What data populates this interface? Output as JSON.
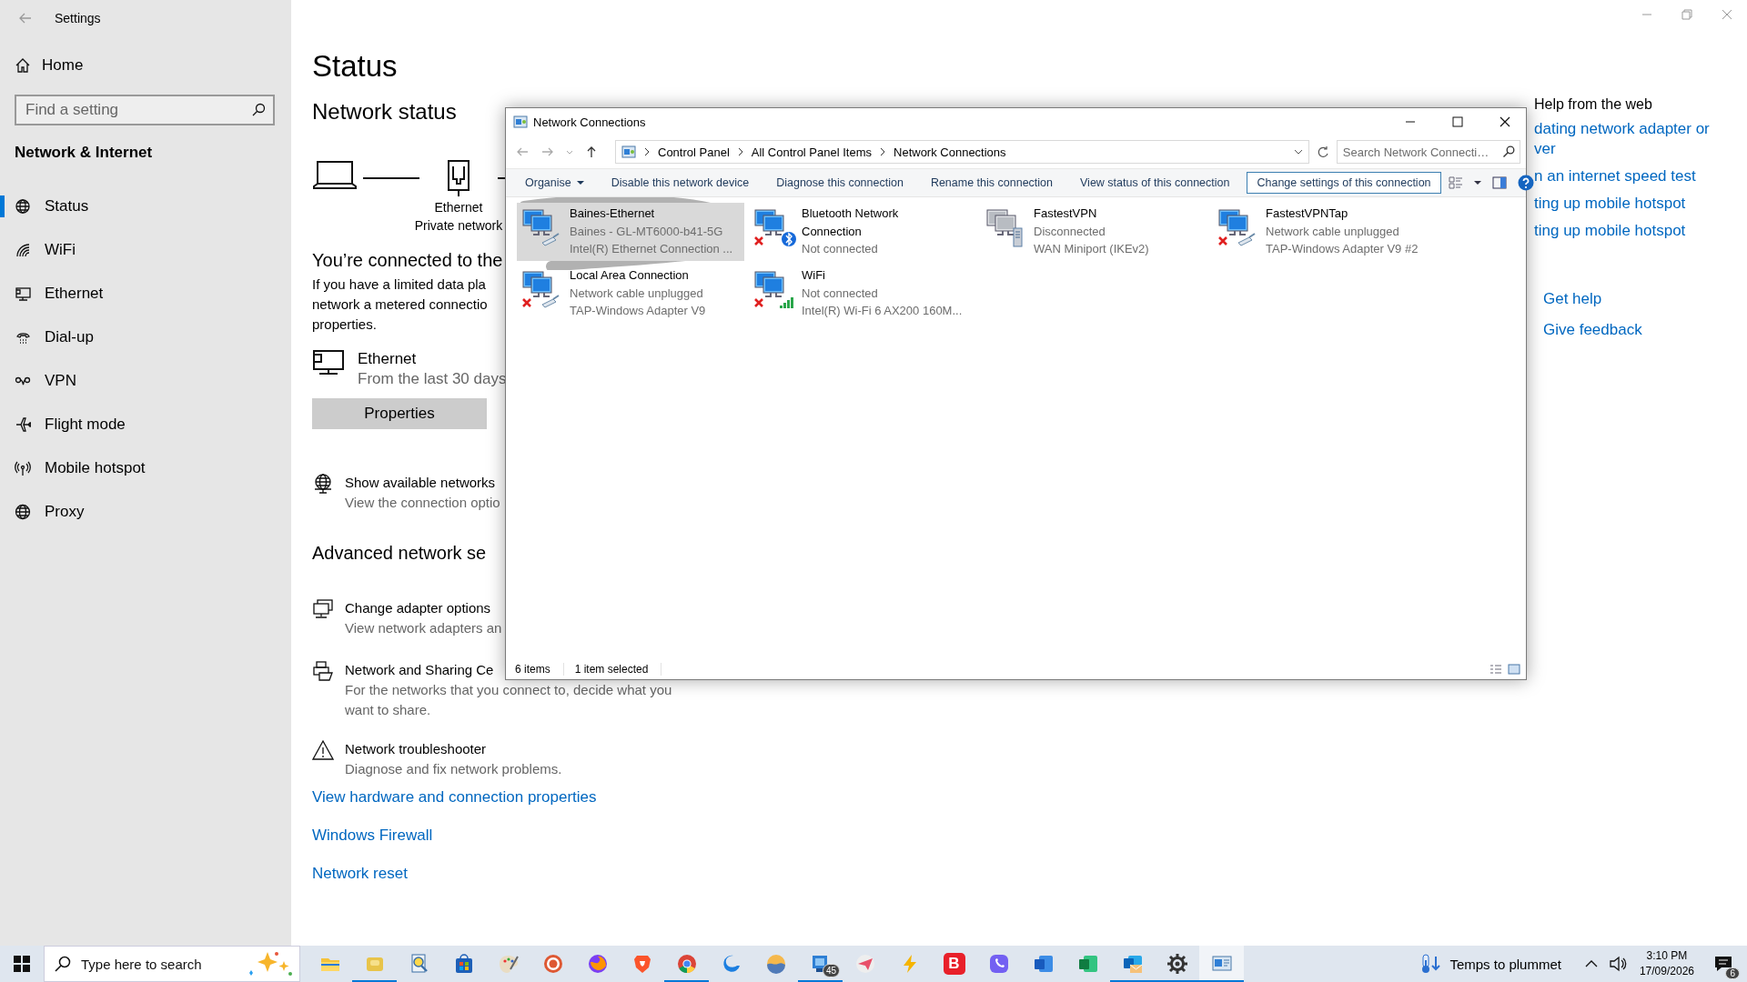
{
  "settings": {
    "title": "Settings",
    "home": "Home",
    "search": {
      "placeholder": "Find a setting"
    },
    "section": "Network & Internet",
    "nav": [
      {
        "label": "Status",
        "selected": true
      },
      {
        "label": "WiFi",
        "selected": false
      },
      {
        "label": "Ethernet",
        "selected": false
      },
      {
        "label": "Dial-up",
        "selected": false
      },
      {
        "label": "VPN",
        "selected": false
      },
      {
        "label": "Flight mode",
        "selected": false
      },
      {
        "label": "Mobile hotspot",
        "selected": false
      },
      {
        "label": "Proxy",
        "selected": false
      }
    ]
  },
  "status_page": {
    "title": "Status",
    "network_status": "Network status",
    "diagram": {
      "adapter": "Ethernet",
      "network": "Private network"
    },
    "connected_heading": "You’re connected to the",
    "body_lines": [
      "If you have a limited data pla",
      "network a metered connectio",
      "properties."
    ],
    "usage": {
      "name": "Ethernet",
      "detail": "From the last 30 days"
    },
    "properties_button": "Properties",
    "show_networks": {
      "title": "Show available networks",
      "detail": "View the connection optio"
    },
    "advanced_heading": "Advanced network se",
    "options": [
      {
        "title": "Change adapter options",
        "detail": "View network adapters an"
      },
      {
        "title": "Network and Sharing Ce",
        "detail": "For the networks that you connect to, decide what you want to share."
      },
      {
        "title": "Network troubleshooter",
        "detail": "Diagnose and fix network problems."
      }
    ],
    "links": [
      "View hardware and connection properties",
      "Windows Firewall",
      "Network reset"
    ]
  },
  "help_panel": {
    "title": "Help from the web",
    "links": [
      {
        "lines": [
          "dating network adapter or",
          "ver"
        ]
      },
      {
        "lines": [
          "n an internet speed test"
        ]
      },
      {
        "lines": [
          "ting up mobile hotspot"
        ]
      },
      {
        "lines": [
          "ting up mobile hotspot"
        ]
      }
    ],
    "support": [
      "Get help",
      "Give feedback"
    ]
  },
  "network_connections": {
    "title": "Network Connections",
    "breadcrumb": [
      "Control Panel",
      "All Control Panel Items",
      "Network Connections"
    ],
    "search": {
      "placeholder": "Search Network Connecti…"
    },
    "toolbar": [
      {
        "label": "Organise",
        "kind": "menu",
        "focused": false
      },
      {
        "label": "Disable this network device",
        "kind": "command",
        "focused": false
      },
      {
        "label": "Diagnose this connection",
        "kind": "command",
        "focused": false
      },
      {
        "label": "Rename this connection",
        "kind": "command",
        "focused": false
      },
      {
        "label": "View status of this connection",
        "kind": "command",
        "focused": false
      },
      {
        "label": "Change settings of this connection",
        "kind": "command",
        "focused": true
      }
    ],
    "items": [
      {
        "name": "Baines-Ethernet",
        "lines": [
          "Baines - GL-MT6000-b41-5G",
          "Intel(R) Ethernet Connection ..."
        ],
        "kind": "ethernet",
        "disconnected": false,
        "selected": true
      },
      {
        "name": "Bluetooth Network Connection",
        "lines": [
          "Not connected"
        ],
        "kind": "bluetooth",
        "disconnected": true,
        "selected": false
      },
      {
        "name": "FastestVPN",
        "lines": [
          "Disconnected",
          "WAN Miniport (IKEv2)"
        ],
        "kind": "vpn",
        "disconnected": false,
        "selected": false
      },
      {
        "name": "FastestVPNTap",
        "lines": [
          "Network cable unplugged",
          "TAP-Windows Adapter V9 #2"
        ],
        "kind": "tap",
        "disconnected": true,
        "selected": false
      },
      {
        "name": "Local Area Connection",
        "lines": [
          "Network cable unplugged",
          "TAP-Windows Adapter V9"
        ],
        "kind": "tap",
        "disconnected": true,
        "selected": false
      },
      {
        "name": "WiFi",
        "lines": [
          "Not connected",
          "Intel(R) Wi-Fi 6 AX200 160M..."
        ],
        "kind": "wifi",
        "disconnected": true,
        "selected": false
      }
    ],
    "status_bar": [
      "6 items",
      "1 item selected"
    ]
  },
  "taskbar": {
    "search": {
      "placeholder": "Type here to search"
    },
    "apps": [
      {
        "running": false,
        "active": false
      },
      {
        "running": true,
        "active": false
      },
      {
        "running": false,
        "active": false
      },
      {
        "running": false,
        "active": false
      },
      {
        "running": false,
        "active": false
      },
      {
        "running": false,
        "active": false
      },
      {
        "running": false,
        "active": false
      },
      {
        "running": false,
        "active": false
      },
      {
        "running": true,
        "active": false
      },
      {
        "running": false,
        "active": false
      },
      {
        "running": false,
        "active": false
      },
      {
        "running": true,
        "active": false,
        "badge": "45"
      },
      {
        "running": false,
        "active": false
      },
      {
        "running": false,
        "active": false
      },
      {
        "running": false,
        "active": false,
        "label": "B"
      },
      {
        "running": false,
        "active": false
      },
      {
        "running": false,
        "active": false
      },
      {
        "running": false,
        "active": false
      },
      {
        "running": true,
        "active": false
      },
      {
        "running": true,
        "active": false
      },
      {
        "running": true,
        "active": true
      }
    ],
    "weather": "Temps to plummet",
    "clock": {
      "time": "3:10 PM",
      "date": "17/09/2026"
    },
    "notifications": "6"
  }
}
